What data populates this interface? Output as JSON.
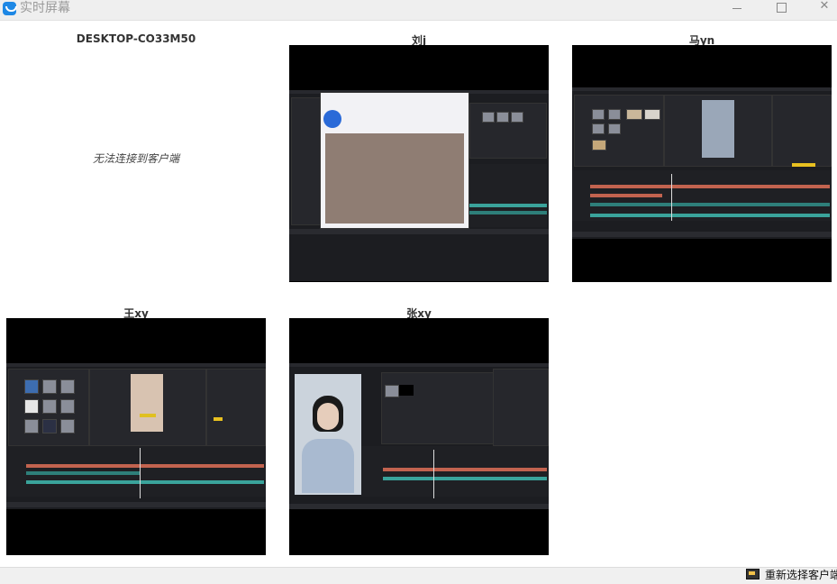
{
  "window": {
    "title": "实时屏幕",
    "icon": "remote-screen-icon",
    "accent": "#1e88e5"
  },
  "clients": [
    {
      "name": "DESKTOP-CO33M50",
      "status": "无法连接到客户端"
    },
    {
      "name": "刘j"
    },
    {
      "name": "马yn"
    },
    {
      "name": "王xy"
    },
    {
      "name": "张xy"
    }
  ],
  "footer": {
    "reselect_label": "重新选择客户端",
    "reselect_icon": "monitor-icon"
  }
}
